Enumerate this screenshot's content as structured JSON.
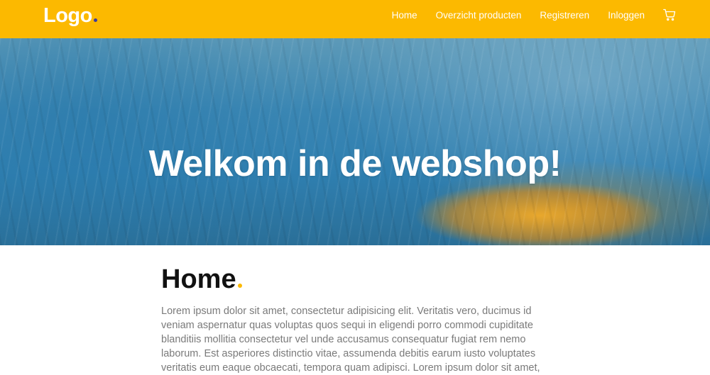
{
  "colors": {
    "header_bg": "#fcb900",
    "logo_dot": "#3b3ba0",
    "title_dot": "#fcb900"
  },
  "header": {
    "logo_text": "Logo",
    "nav_items": [
      {
        "label": "Home"
      },
      {
        "label": "Overzicht producten"
      },
      {
        "label": "Registreren"
      },
      {
        "label": "Inloggen"
      }
    ],
    "cart_icon": "shopping-cart-icon"
  },
  "hero": {
    "title": "Welkom in de webshop!"
  },
  "main": {
    "title": "Home",
    "text": "Lorem ipsum dolor sit amet, consectetur adipisicing elit. Veritatis vero, ducimus id veniam aspernatur quas voluptas quos sequi in eligendi porro commodi cupiditate blanditiis mollitia consectetur vel unde accusamus consequatur fugiat rem nemo laborum. Est asperiores distinctio vitae, assumenda debitis earum iusto voluptates veritatis eum eaque obcaecati, tempora quam adipisci. Lorem ipsum dolor sit amet,"
  }
}
